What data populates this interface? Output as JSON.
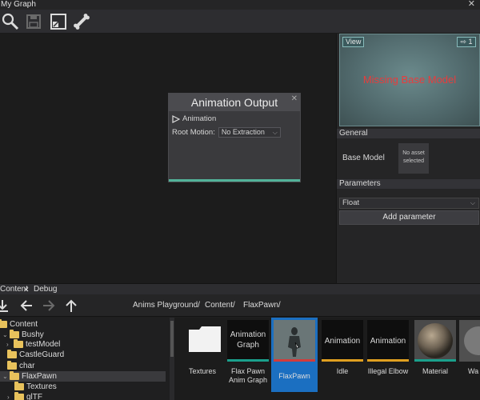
{
  "window": {
    "title": "My Graph",
    "close_glyph": "✕"
  },
  "toolbar": {
    "icons": [
      "search-icon",
      "save-icon",
      "layout-icon",
      "bone-icon"
    ]
  },
  "node": {
    "title": "Animation Output",
    "close_glyph": "✕",
    "pin_label": "Animation",
    "root_motion_label": "Root Motion:",
    "root_motion_value": "No Extraction",
    "accent_color": "#52b39a"
  },
  "viewport": {
    "view_button": "View",
    "flag_count": "1",
    "missing_text": "Missing Base Model"
  },
  "properties": {
    "general_header": "General",
    "base_model_label": "Base Model",
    "no_asset_line1": "No asset",
    "no_asset_line2": "selected",
    "parameters_header": "Parameters",
    "param_type": "Float",
    "add_param_button": "Add parameter"
  },
  "tabs": {
    "content": "Content",
    "debug": "Debug"
  },
  "breadcrumb": {
    "items": [
      "Anims Playground/",
      "Content/",
      "FlaxPawn/"
    ]
  },
  "tree": {
    "items": [
      "Content",
      "Bushy",
      "testModel",
      "CastleGuard",
      "char",
      "FlaxPawn",
      "Textures",
      "glTF"
    ]
  },
  "assets": {
    "items": [
      {
        "thumb": "",
        "name": "Textures"
      },
      {
        "thumb": "Animation Graph",
        "name": "Flax Pawn Anim Graph"
      },
      {
        "thumb": "",
        "name": "FlaxPawn"
      },
      {
        "thumb": "Animation",
        "name": "Idle"
      },
      {
        "thumb": "Animation",
        "name": "Illegal Elbow"
      },
      {
        "thumb": "",
        "name": "Material"
      },
      {
        "thumb": "",
        "name": "Wa"
      }
    ]
  }
}
